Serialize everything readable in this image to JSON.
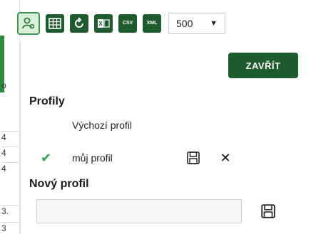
{
  "toolbar": {
    "buttons": [
      {
        "name": "profiles",
        "icon": "user-settings-icon",
        "active": true
      },
      {
        "name": "columns",
        "icon": "table-grid-icon"
      },
      {
        "name": "reset",
        "icon": "refresh-icon"
      },
      {
        "name": "export-excel",
        "icon": "excel-icon"
      },
      {
        "name": "export-csv",
        "icon": "csv-icon",
        "text": "CSV"
      },
      {
        "name": "export-xml",
        "icon": "xml-icon",
        "text": "XML"
      }
    ],
    "rows_per_page": "500",
    "rows_arrow": "▼"
  },
  "background_table": {
    "cells": [
      "o",
      "4",
      "4",
      "4",
      "3.",
      "3"
    ]
  },
  "panel": {
    "close_label": "ZAVŘÍT",
    "profiles_title": "Profily",
    "profiles": [
      {
        "label": "Výchozí profil",
        "selected": false
      },
      {
        "label": "můj profil",
        "selected": true,
        "check": "✔",
        "delete": "✕"
      }
    ],
    "new_profile_title": "Nový profil",
    "new_profile_placeholder": ""
  },
  "colors": {
    "primary": "#1e5b2e",
    "active_bg": "#d9efd9",
    "check": "#2aa84a"
  }
}
